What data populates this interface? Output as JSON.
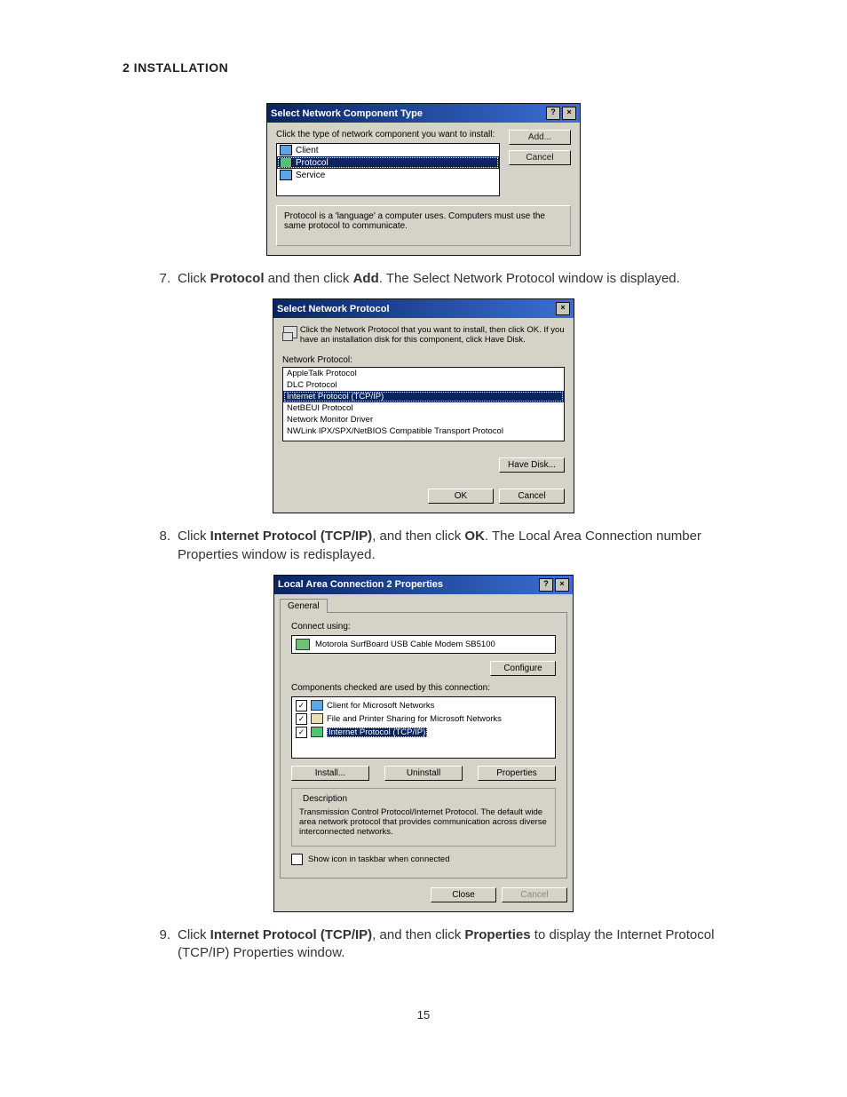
{
  "section_title": "2 INSTALLATION",
  "page_number": "15",
  "steps": {
    "seven": {
      "num": "7.",
      "t1": "Click ",
      "b1": "Protocol",
      "t2": " and then click ",
      "b2": "Add",
      "t3": ". The Select Network Protocol window is displayed."
    },
    "eight": {
      "num": "8.",
      "t1": "Click ",
      "b1": "Internet Protocol (TCP/IP)",
      "t2": ", and then click ",
      "b2": "OK",
      "t3": ". The Local Area Connection number Properties window is redisplayed."
    },
    "nine": {
      "num": "9.",
      "t1": "Click ",
      "b1": "Internet Protocol (TCP/IP)",
      "t2": ", and then click ",
      "b2": "Properties",
      "t3": " to display the Internet Protocol (TCP/IP) Properties window."
    }
  },
  "dialog1": {
    "title": "Select Network Component Type",
    "help": "?",
    "close": "×",
    "prompt": "Click the type of network component you want to install:",
    "items": {
      "client": "Client",
      "protocol": "Protocol",
      "service": "Service"
    },
    "add": "Add...",
    "cancel": "Cancel",
    "desc": "Protocol is a 'language' a computer uses. Computers must use the same protocol to communicate."
  },
  "dialog2": {
    "title": "Select Network Protocol",
    "close": "×",
    "intro": "Click the Network Protocol that you want to install, then click OK. If you have an installation disk for this component, click Have Disk.",
    "label": "Network Protocol:",
    "items": {
      "appletalk": "AppleTalk Protocol",
      "dlc": "DLC Protocol",
      "tcpip": "Internet Protocol (TCP/IP)",
      "netbeui": "NetBEUI Protocol",
      "monitor": "Network Monitor Driver",
      "nwlink": "NWLink IPX/SPX/NetBIOS Compatible Transport Protocol"
    },
    "have_disk": "Have Disk...",
    "ok": "OK",
    "cancel": "Cancel"
  },
  "dialog3": {
    "title": "Local Area Connection 2 Properties",
    "help": "?",
    "close": "×",
    "tab": "General",
    "connect_using": "Connect using:",
    "device": "Motorola SurfBoard USB Cable Modem SB5100",
    "configure": "Configure",
    "components_label": "Components checked are used by this connection:",
    "components": {
      "client": "Client for Microsoft Networks",
      "fps": "File and Printer Sharing for Microsoft Networks",
      "tcpip": "Internet Protocol (TCP/IP)"
    },
    "install": "Install...",
    "uninstall": "Uninstall",
    "properties": "Properties",
    "desc_title": "Description",
    "desc": "Transmission Control Protocol/Internet Protocol. The default wide area network protocol that provides communication across diverse interconnected networks.",
    "show_icon": "Show icon in taskbar when connected",
    "close_btn": "Close",
    "cancel": "Cancel"
  }
}
